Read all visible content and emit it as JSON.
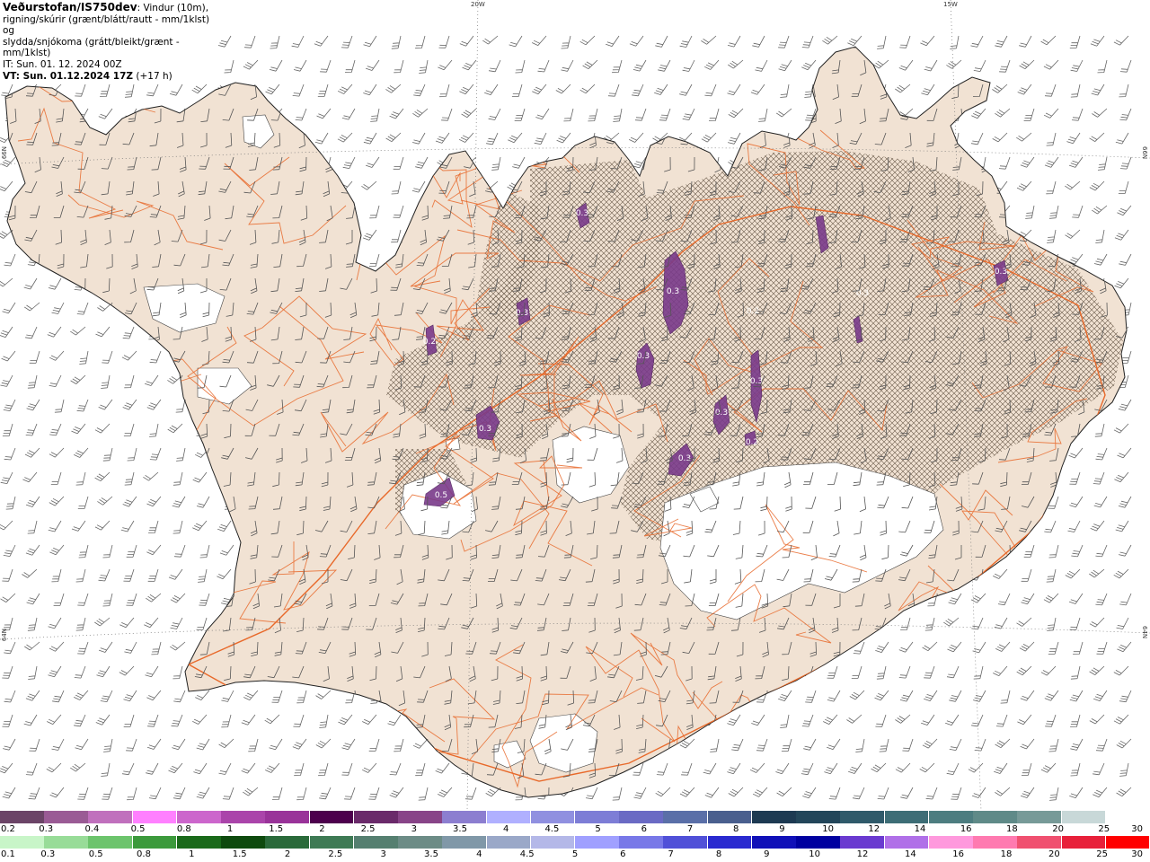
{
  "header": {
    "title": "Veðurstofan/IS750dev",
    "description_line1": ": Vindur (10m),",
    "description_line2": "rigning/skúrir (grænt/blátt/rautt - mm/1klst) og",
    "description_line3": "slydda/snjókoma (grátt/bleikt/grænt - mm/1klst)",
    "init_time": "IT: Sun. 01. 12. 2024 00Z",
    "valid_time": "VT: Sun. 01.12.2024 17Z",
    "lead_time": "(+17 h)"
  },
  "grid_labels": {
    "lon_20w": "20W",
    "lon_15w": "15W",
    "lat_66n": "66N",
    "lat_64n": "64N"
  },
  "precip_labels": [
    "0.3",
    "0.3",
    "0.3",
    "0.5",
    "0.3",
    "0.3",
    "0.3",
    "0.3",
    "0.3",
    "0.2",
    "0.3",
    "0.2",
    "0.3",
    "0.2"
  ],
  "legend_sleet_snow": {
    "labels": [
      "0.2",
      "0.3",
      "0.4",
      "0.5",
      "0.8",
      "1",
      "1.5",
      "2",
      "2.5",
      "3",
      "3.5",
      "4",
      "4.5",
      "5",
      "6",
      "7",
      "8",
      "9",
      "10",
      "12",
      "14",
      "16",
      "18",
      "20",
      "25",
      "30"
    ],
    "colors": [
      "#6b4467",
      "#9a5b95",
      "#c070bd",
      "#ff80ff",
      "#cc66cc",
      "#aa44aa",
      "#993399",
      "#4d004d",
      "#6a2a6a",
      "#884488",
      "#8c7ed0",
      "#b0b0ff",
      "#9090e0",
      "#7d7dd6",
      "#6a6ac4",
      "#5a6fa8",
      "#4a5f8e",
      "#1d3a52",
      "#23465a",
      "#2f5a6a",
      "#3d6d76",
      "#4d7d80",
      "#5f8a88",
      "#779a98",
      "#c8d8d8",
      "#ffffff"
    ]
  },
  "legend_rain": {
    "labels": [
      "0.1",
      "0.3",
      "0.5",
      "0.8",
      "1",
      "1.5",
      "2",
      "2.5",
      "3",
      "3.5",
      "4",
      "4.5",
      "5",
      "6",
      "7",
      "8",
      "9",
      "10",
      "12",
      "14",
      "16",
      "18",
      "20",
      "25",
      "30"
    ],
    "colors": [
      "#c8f5c8",
      "#98dc98",
      "#6cc46c",
      "#3c9a3c",
      "#1a6a1a",
      "#0e4a0e",
      "#2a6a3a",
      "#3e7a54",
      "#557f70",
      "#6c8c86",
      "#8098a8",
      "#9aa8c8",
      "#b4b8e8",
      "#a0a0ff",
      "#7878e8",
      "#5050d8",
      "#2a2ad0",
      "#1010b8",
      "#0000a0",
      "#6a3ad0",
      "#b070e8",
      "#ff99dd",
      "#ff7ab0",
      "#f05070",
      "#e8203a",
      "#ff0000"
    ]
  },
  "map_colors": {
    "land": "#f1e2d3",
    "ice": "#ffffff",
    "coast": "#222222",
    "roads": "#e8692a",
    "barbs": "#444444",
    "hatch": "#6a5a4a",
    "precip": "#7a3a8a"
  }
}
